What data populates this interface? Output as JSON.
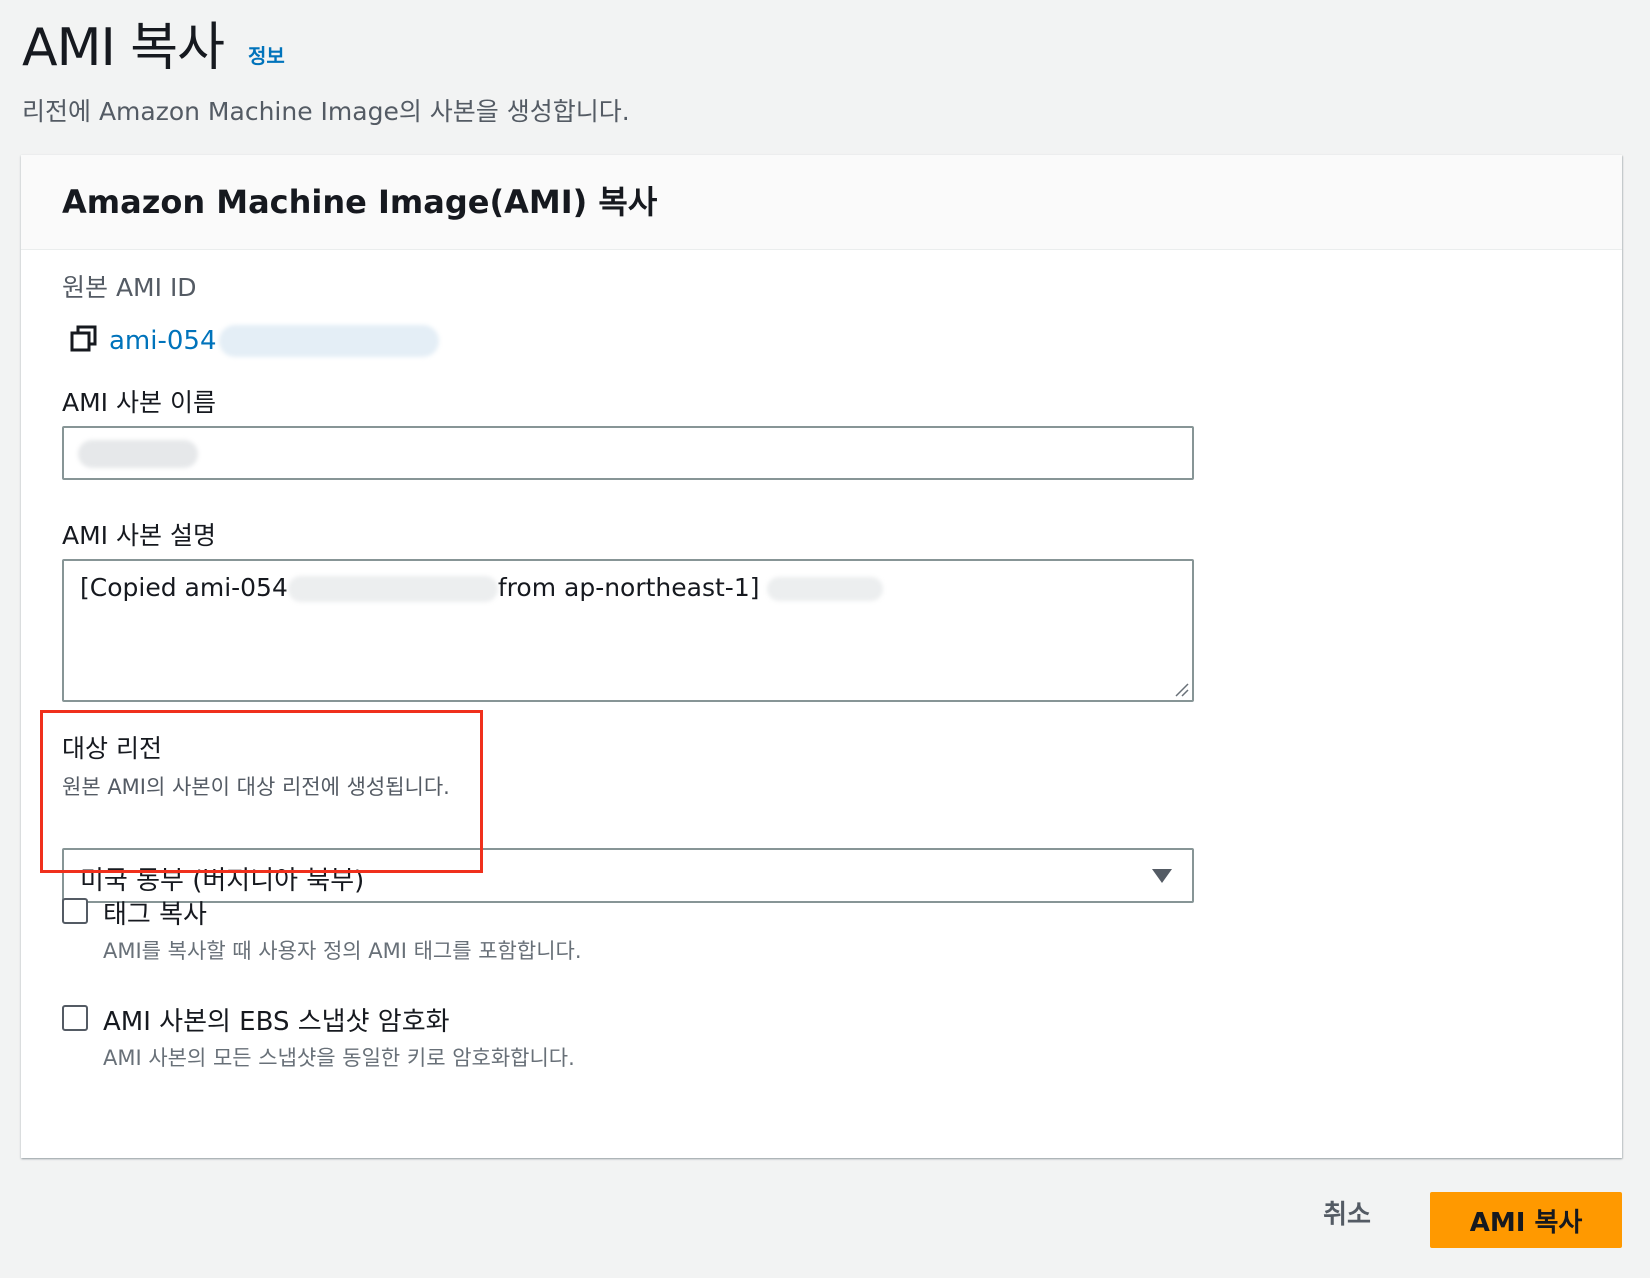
{
  "page": {
    "title": "AMI 복사",
    "info_link": "정보",
    "description": "리전에 Amazon Machine Image의 사본을 생성합니다."
  },
  "panel": {
    "title": "Amazon Machine Image(AMI) 복사",
    "source_ami": {
      "label": "원본 AMI ID",
      "value": "ami-054"
    },
    "copy_name": {
      "label": "AMI 사본 이름",
      "value": ""
    },
    "copy_description": {
      "label": "AMI 사본 설명",
      "value_part1": "[Copied ami-054",
      "value_part2": "from ap-northeast-1]"
    },
    "target_region": {
      "label": "대상 리전",
      "hint": "원본 AMI의 사본이 대상 리전에 생성됩니다.",
      "selected": "미국 동부 (버지니아 북부)"
    },
    "copy_tags": {
      "label": "태그 복사",
      "description": "AMI를 복사할 때 사용자 정의 AMI 태그를 포함합니다.",
      "checked": false
    },
    "encrypt": {
      "label": "AMI 사본의 EBS 스냅샷 암호화",
      "description": "AMI 사본의 모든 스냅샷을 동일한 키로 암호화합니다.",
      "checked": false
    }
  },
  "actions": {
    "cancel": "취소",
    "submit": "AMI 복사"
  },
  "colors": {
    "link": "#0073bb",
    "primary_button": "#ff9900",
    "highlight_border": "#f0301c"
  }
}
